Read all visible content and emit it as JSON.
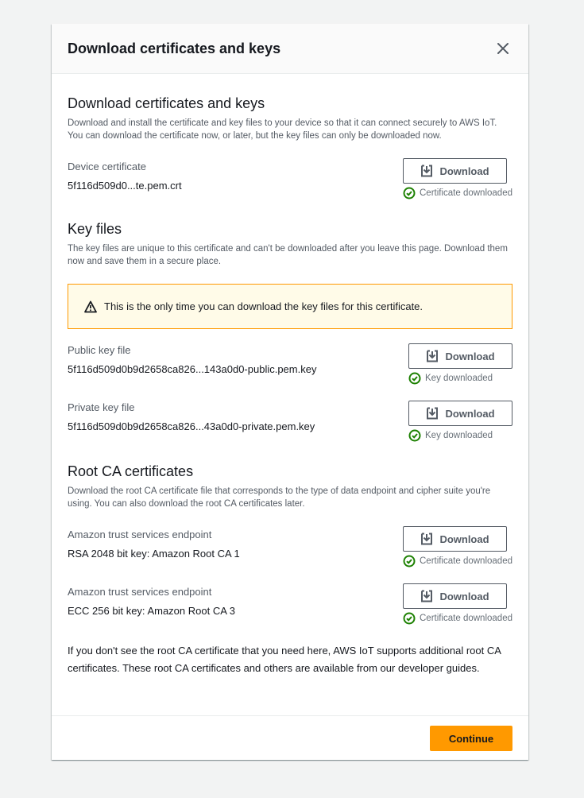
{
  "modal": {
    "title": "Download certificates and keys"
  },
  "device_section": {
    "title": "Download certificates and keys",
    "description": "Download and install the certificate and key files to your device so that it can connect securely to AWS IoT. You can download the certificate now, or later, but the key files can only be downloaded now.",
    "item": {
      "label": "Device certificate",
      "value": "5f116d509d0...te.pem.crt",
      "button": "Download",
      "status": "Certificate downloaded"
    }
  },
  "key_section": {
    "title": "Key files",
    "description": "The key files are unique to this certificate and can't be downloaded after you leave this page. Download them now and save them in a secure place.",
    "alert": "This is the only time you can download the key files for this certificate.",
    "items": [
      {
        "label": "Public key file",
        "value": "5f116d509d0b9d2658ca826...143a0d0-public.pem.key",
        "button": "Download",
        "status": "Key downloaded"
      },
      {
        "label": "Private key file",
        "value": "5f116d509d0b9d2658ca826...43a0d0-private.pem.key",
        "button": "Download",
        "status": "Key downloaded"
      }
    ]
  },
  "root_section": {
    "title": "Root CA certificates",
    "description": "Download the root CA certificate file that corresponds to the type of data endpoint and cipher suite you're using. You can also download the root CA certificates later.",
    "items": [
      {
        "label": "Amazon trust services endpoint",
        "value": "RSA 2048 bit key: Amazon Root CA 1",
        "button": "Download",
        "status": "Certificate downloaded"
      },
      {
        "label": "Amazon trust services endpoint",
        "value": "ECC 256 bit key: Amazon Root CA 3",
        "button": "Download",
        "status": "Certificate downloaded"
      }
    ],
    "note": "If you don't see the root CA certificate that you need here, AWS IoT supports additional root CA certificates. These root CA certificates and others are available from our developer guides."
  },
  "footer": {
    "continue_label": "Continue"
  },
  "colors": {
    "success": "#1d8102",
    "warning_border": "#ff9900",
    "warning_bg": "#fffbe8",
    "primary_button": "#ff9900"
  },
  "icons": {
    "close": "close-icon",
    "download": "download-icon",
    "success": "success-check-icon",
    "warning": "warning-icon"
  }
}
